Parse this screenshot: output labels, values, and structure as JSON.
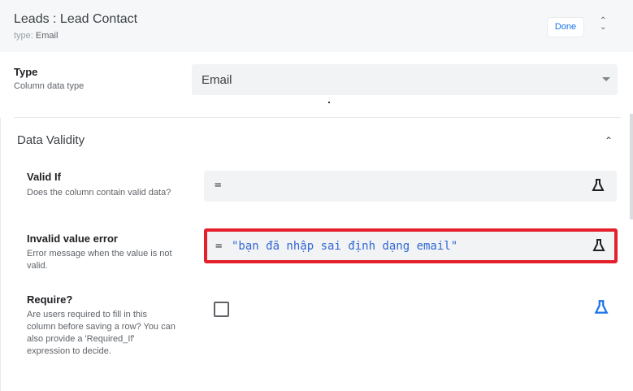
{
  "header": {
    "title": "Leads : Lead Contact",
    "subtitle_prefix": "type:",
    "subtitle_value": "Email",
    "done_label": "Done"
  },
  "type_field": {
    "label": "Type",
    "description": "Column data type",
    "value": "Email"
  },
  "section": {
    "title": "Data Validity"
  },
  "valid_if": {
    "label": "Valid If",
    "description": "Does the column contain valid data?",
    "prefix": "="
  },
  "invalid_error": {
    "label": "Invalid value error",
    "description": "Error message when the value is not valid.",
    "prefix": "=",
    "value": "\"bạn đã nhập sai định dạng email\""
  },
  "require": {
    "label": "Require?",
    "description": "Are users required to fill in this column before saving a row? You can also provide a 'Required_If' expression to decide.",
    "checked": false
  },
  "colors": {
    "accent": "#1a73e8",
    "highlight": "#e4202c"
  }
}
